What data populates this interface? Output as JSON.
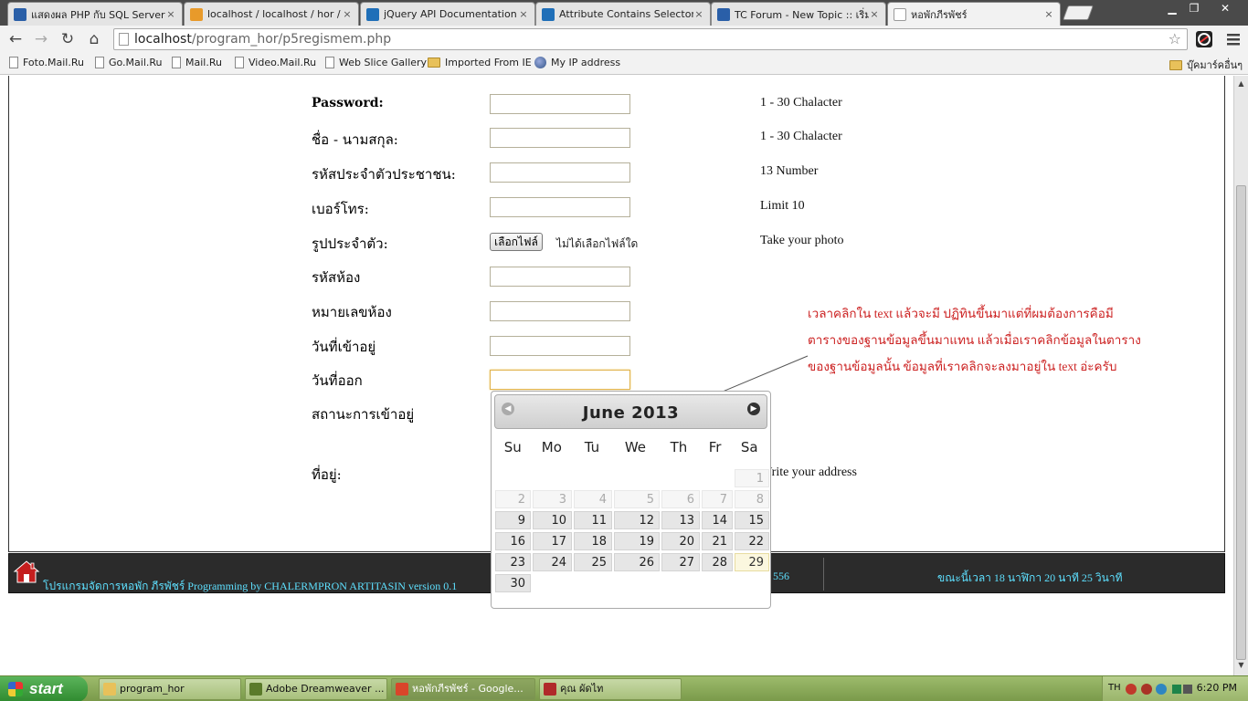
{
  "browser": {
    "tabs": [
      {
        "title": "แสดงผล PHP กับ SQL Server",
        "icon_color": "#2a5fa8",
        "icon_label": ""
      },
      {
        "title": "localhost / localhost / hor / m",
        "icon_color": "#e89a2a",
        "icon_label": "PMA"
      },
      {
        "title": "jQuery API Documentation",
        "icon_color": "#1f6fb8",
        "icon_label": ""
      },
      {
        "title": "Attribute Contains Selector [",
        "icon_color": "#1f6fb8",
        "icon_label": ""
      },
      {
        "title": "TC Forum - New Topic :: เริ่ม",
        "icon_color": "#2a5fa8",
        "icon_label": ""
      },
      {
        "title": "หอพักภีรพัชร์",
        "icon_color": "#ffffff",
        "icon_label": ""
      }
    ],
    "active_tab": 5,
    "close_glyph": "×",
    "url_host": "localhost",
    "url_path": "/program_hor/p5regismem.php",
    "bookmarks": [
      {
        "label": "Foto.Mail.Ru",
        "kind": "doc"
      },
      {
        "label": "Go.Mail.Ru",
        "kind": "doc"
      },
      {
        "label": "Mail.Ru",
        "kind": "doc"
      },
      {
        "label": "Video.Mail.Ru",
        "kind": "doc"
      },
      {
        "label": "Web Slice Gallery",
        "kind": "doc"
      },
      {
        "label": "Imported From IE",
        "kind": "folder"
      },
      {
        "label": "My IP address",
        "kind": "globe"
      }
    ],
    "other_bookmarks": "บุ๊คมาร์คอื่นๆ"
  },
  "form": {
    "password_label": "Password:",
    "password_hint": "1 - 30 Chalacter",
    "name_label": "ชื่อ - นามสกุล:",
    "name_hint": "1 - 30 Chalacter",
    "idcard_label": "รหัสประจำตัวประชาชน:",
    "idcard_hint": "13 Number",
    "phone_label": "เบอร์โทร:",
    "phone_hint": "Limit 10",
    "photo_label": "รูปประจำตัว:",
    "photo_button": "เลือกไฟล์",
    "photo_none": "ไม่ได้เลือกไฟล์ใด",
    "photo_hint": "Take your photo",
    "room_code_label": "รหัสห้อง",
    "room_number_label": "หมายเลขห้อง",
    "checkin_label": "วันที่เข้าอยู่",
    "checkout_label": "วันที่ออก",
    "status_label": "สถานะการเข้าอยู่",
    "address_label": "ที่อยู่:",
    "address_hint": "Write your address"
  },
  "note": "เวลาคลิกใน text แล้วจะมี ปฏิทินขึ้นมาแต่ที่ผมต้องการคือมีตารางของฐานข้อมูลขึ้นมาแทน แล้วเมื่อเราคลิกข้อมูลในตารางของฐานข้อมูลนั้น ข้อมูลที่เราคลิกจะลงมาอยู่ใน text อ่ะครับ",
  "footer": {
    "program_text": "โปรแกรมจัดการหอพัก ภีรพัชร์ Programming by CHALERMPRON ARTITASIN version 0.1",
    "date_fragment": "556",
    "time_text": "ขณะนี้เวลา 18 นาฬิกา 20 นาที 25 วินาที"
  },
  "datepicker": {
    "title": "June 2013",
    "weekdays": [
      "Su",
      "Mo",
      "Tu",
      "We",
      "Th",
      "Fr",
      "Sa"
    ],
    "weeks": [
      [
        null,
        null,
        null,
        null,
        null,
        null,
        1
      ],
      [
        2,
        3,
        4,
        5,
        6,
        7,
        8
      ],
      [
        9,
        10,
        11,
        12,
        13,
        14,
        15
      ],
      [
        16,
        17,
        18,
        19,
        20,
        21,
        22
      ],
      [
        23,
        24,
        25,
        26,
        27,
        28,
        29
      ],
      [
        30,
        null,
        null,
        null,
        null,
        null,
        null
      ]
    ],
    "muted_days": [
      1,
      2,
      3,
      4,
      5,
      6,
      7,
      8
    ],
    "today": 29
  },
  "taskbar": {
    "start_label": "start",
    "tasks": [
      {
        "label": "program_hor",
        "color": "#e8c15a"
      },
      {
        "label": "Adobe Dreamweaver ...",
        "color": "#5a7a2a"
      },
      {
        "label": "หอพักภีรพัชร์ - Google...",
        "color": "#d9452a"
      },
      {
        "label": "คุณ ผัดไท",
        "color": "#b02a2a"
      }
    ],
    "active_task": 2,
    "lang": "TH",
    "clock": "6:20 PM"
  }
}
